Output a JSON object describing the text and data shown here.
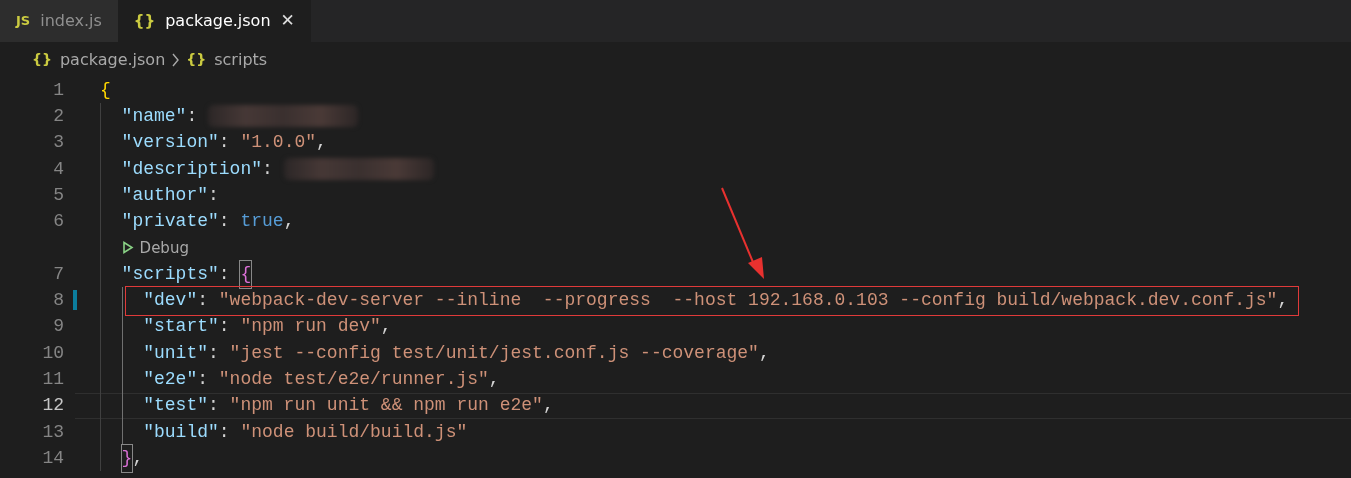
{
  "tabs": [
    {
      "icon": "JS",
      "label": "index.js",
      "selected": false
    },
    {
      "icon": "{}",
      "label": "package.json",
      "selected": true,
      "close": "✕"
    }
  ],
  "breadcrumbs": [
    {
      "icon": "{}",
      "label": "package.json"
    },
    {
      "icon": "{}",
      "label": "scripts"
    }
  ],
  "editor": {
    "lines": [
      {
        "kind": "code",
        "number": "1",
        "current": false,
        "modified": false,
        "boxed": false,
        "tokens": [
          {
            "kind": "bracket",
            "text": "{",
            "matched": false
          }
        ],
        "children": [
          {
            "kind": "code",
            "number": "2",
            "current": false,
            "modified": false,
            "boxed": false,
            "tokens": [
              {
                "kind": "key",
                "text": "\"name\""
              },
              {
                "kind": "punct",
                "text": ": "
              },
              {
                "kind": "redacted"
              }
            ]
          },
          {
            "kind": "code",
            "number": "3",
            "current": false,
            "modified": false,
            "boxed": false,
            "tokens": [
              {
                "kind": "key",
                "text": "\"version\""
              },
              {
                "kind": "punct",
                "text": ": "
              },
              {
                "kind": "string",
                "text": "\"1.0.0\""
              },
              {
                "kind": "punct",
                "text": ","
              }
            ]
          },
          {
            "kind": "code",
            "number": "4",
            "current": false,
            "modified": false,
            "boxed": false,
            "tokens": [
              {
                "kind": "key",
                "text": "\"description\""
              },
              {
                "kind": "punct",
                "text": ": "
              },
              {
                "kind": "redacted"
              }
            ]
          },
          {
            "kind": "code",
            "number": "5",
            "current": false,
            "modified": false,
            "boxed": false,
            "tokens": [
              {
                "kind": "key",
                "text": "\"author\""
              },
              {
                "kind": "punct",
                "text": ":"
              }
            ]
          },
          {
            "kind": "code",
            "number": "6",
            "current": false,
            "modified": false,
            "boxed": false,
            "tokens": [
              {
                "kind": "key",
                "text": "\"private\""
              },
              {
                "kind": "punct",
                "text": ": "
              },
              {
                "kind": "bool",
                "text": "true"
              },
              {
                "kind": "punct",
                "text": ","
              }
            ]
          },
          {
            "kind": "codelens",
            "label": "Debug"
          },
          {
            "kind": "code",
            "number": "7",
            "current": false,
            "modified": false,
            "boxed": false,
            "tokens": [
              {
                "kind": "key",
                "text": "\"scripts\""
              },
              {
                "kind": "punct",
                "text": ": "
              },
              {
                "kind": "bracket",
                "text": "{",
                "matched": true
              }
            ],
            "children": [
              {
                "kind": "code",
                "number": "8",
                "current": false,
                "modified": true,
                "boxed": true,
                "tokens": [
                  {
                    "kind": "key",
                    "text": "\"dev\""
                  },
                  {
                    "kind": "punct",
                    "text": ": "
                  },
                  {
                    "kind": "string",
                    "text": "\"webpack-dev-server --inline  --progress  --host 192.168.0.103 --config build/webpack.dev.conf.js\""
                  },
                  {
                    "kind": "punct",
                    "text": ","
                  }
                ]
              },
              {
                "kind": "code",
                "number": "9",
                "current": false,
                "modified": false,
                "boxed": false,
                "tokens": [
                  {
                    "kind": "key",
                    "text": "\"start\""
                  },
                  {
                    "kind": "punct",
                    "text": ": "
                  },
                  {
                    "kind": "string",
                    "text": "\"npm run dev\""
                  },
                  {
                    "kind": "punct",
                    "text": ","
                  }
                ]
              },
              {
                "kind": "code",
                "number": "10",
                "current": false,
                "modified": false,
                "boxed": false,
                "tokens": [
                  {
                    "kind": "key",
                    "text": "\"unit\""
                  },
                  {
                    "kind": "punct",
                    "text": ": "
                  },
                  {
                    "kind": "string",
                    "text": "\"jest --config test/unit/jest.conf.js --coverage\""
                  },
                  {
                    "kind": "punct",
                    "text": ","
                  }
                ]
              },
              {
                "kind": "code",
                "number": "11",
                "current": false,
                "modified": false,
                "boxed": false,
                "tokens": [
                  {
                    "kind": "key",
                    "text": "\"e2e\""
                  },
                  {
                    "kind": "punct",
                    "text": ": "
                  },
                  {
                    "kind": "string",
                    "text": "\"node test/e2e/runner.js\""
                  },
                  {
                    "kind": "punct",
                    "text": ","
                  }
                ]
              },
              {
                "kind": "code",
                "number": "12",
                "current": true,
                "modified": false,
                "boxed": false,
                "tokens": [
                  {
                    "kind": "key",
                    "text": "\"test\""
                  },
                  {
                    "kind": "punct",
                    "text": ": "
                  },
                  {
                    "kind": "string",
                    "text": "\"npm run unit && npm run e2e\""
                  },
                  {
                    "kind": "punct",
                    "text": ","
                  }
                ]
              },
              {
                "kind": "code",
                "number": "13",
                "current": false,
                "modified": false,
                "boxed": false,
                "tokens": [
                  {
                    "kind": "key",
                    "text": "\"build\""
                  },
                  {
                    "kind": "punct",
                    "text": ": "
                  },
                  {
                    "kind": "string",
                    "text": "\"node build/build.js\""
                  }
                ]
              }
            ]
          },
          {
            "kind": "code",
            "number": "14",
            "current": false,
            "modified": false,
            "boxed": false,
            "tokens": [
              {
                "kind": "bracket",
                "text": "}",
                "matched": true
              },
              {
                "kind": "punct",
                "text": ","
              }
            ]
          }
        ]
      }
    ]
  }
}
